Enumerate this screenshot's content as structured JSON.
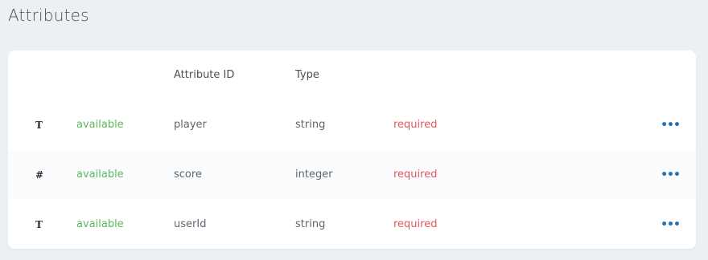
{
  "page": {
    "title": "Attributes"
  },
  "table": {
    "columns": {
      "icon": "",
      "status": "",
      "attribute_id": "Attribute ID",
      "type": "Type",
      "required": "",
      "actions": ""
    },
    "rows": [
      {
        "icon_glyph": "T",
        "icon_name": "text-type-icon",
        "status": "available",
        "attribute_id": "player",
        "type": "string",
        "required": "required",
        "menu": "•••"
      },
      {
        "icon_glyph": "#",
        "icon_name": "number-type-icon",
        "status": "available",
        "attribute_id": "score",
        "type": "integer",
        "required": "required",
        "menu": "•••"
      },
      {
        "icon_glyph": "T",
        "icon_name": "text-type-icon",
        "status": "available",
        "attribute_id": "userId",
        "type": "string",
        "required": "required",
        "menu": "•••"
      }
    ]
  },
  "colors": {
    "background": "#edf0f3",
    "card": "#ffffff",
    "status_available": "#5cb85c",
    "required": "#e2585f",
    "menu_accent": "#2a6fb0"
  }
}
